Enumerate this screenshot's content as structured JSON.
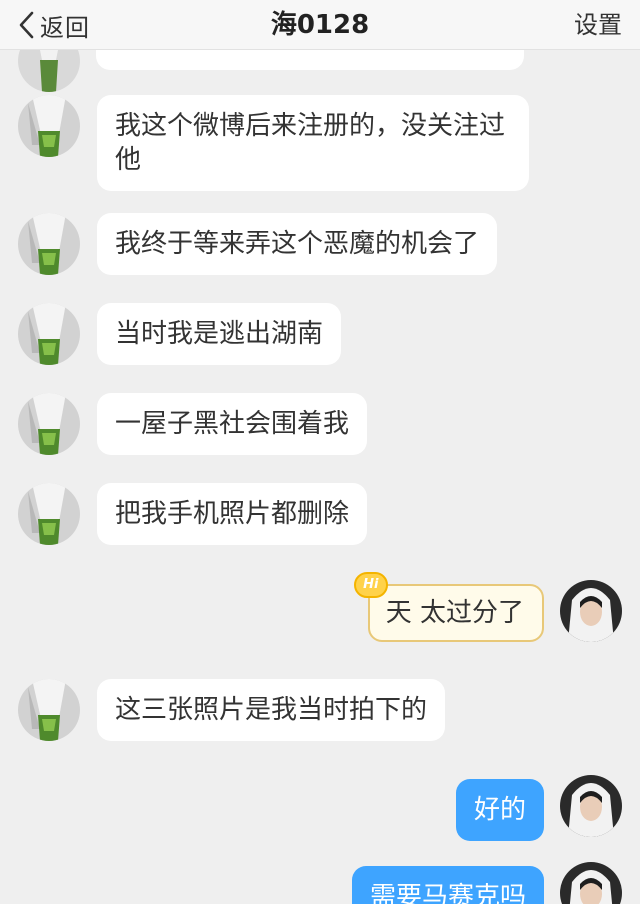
{
  "header": {
    "back_label": "返回",
    "title": "海0128",
    "settings_label": "设置"
  },
  "messages": [
    {
      "side": "left",
      "text": "我这个微博后来注册的，没关注过他"
    },
    {
      "side": "left",
      "text": "我终于等来弄这个恶魔的机会了"
    },
    {
      "side": "left",
      "text": "当时我是逃出湖南"
    },
    {
      "side": "left",
      "text": "一屋子黑社会围着我"
    },
    {
      "side": "left",
      "text": "把我手机照片都删除"
    },
    {
      "side": "right",
      "text": "天 太过分了",
      "badge": "Hi"
    },
    {
      "side": "left",
      "text": "这三张照片是我当时拍下的"
    },
    {
      "side": "right",
      "text": "好的"
    },
    {
      "side": "right",
      "text": "需要马赛克吗"
    }
  ],
  "colors": {
    "background": "#efefef",
    "bubble_left": "#ffffff",
    "bubble_blue": "#3ea4ff",
    "badge": "#ffd24a"
  }
}
